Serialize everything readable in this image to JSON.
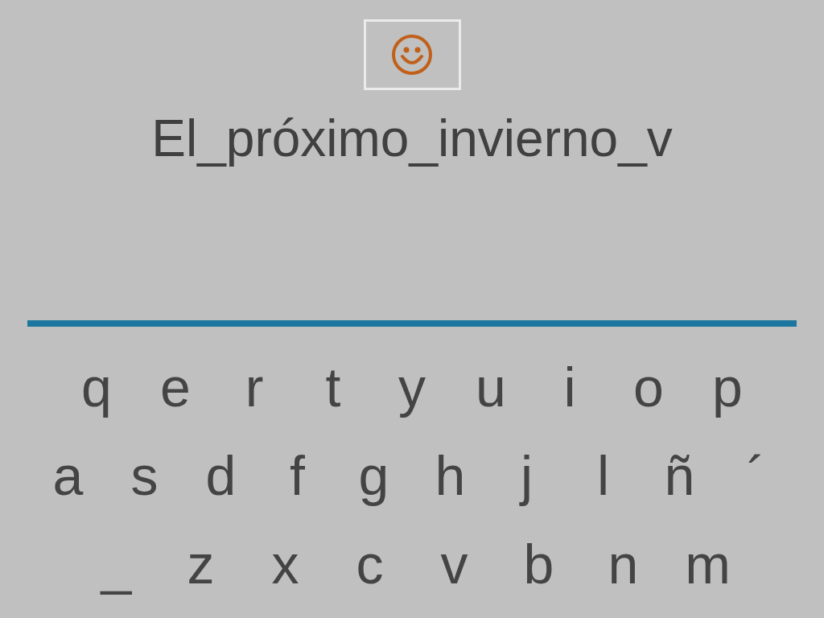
{
  "typed_text": "El_próximo_invierno_v",
  "keyboard_rows": [
    [
      "q",
      "e",
      "r",
      "t",
      "y",
      "u",
      "i",
      "o",
      "p"
    ],
    [
      "a",
      "s",
      "d",
      "f",
      "g",
      "h",
      "j",
      "l",
      "ñ",
      "´"
    ],
    [
      "_",
      "z",
      "x",
      "c",
      "v",
      "b",
      "n",
      "m"
    ]
  ]
}
